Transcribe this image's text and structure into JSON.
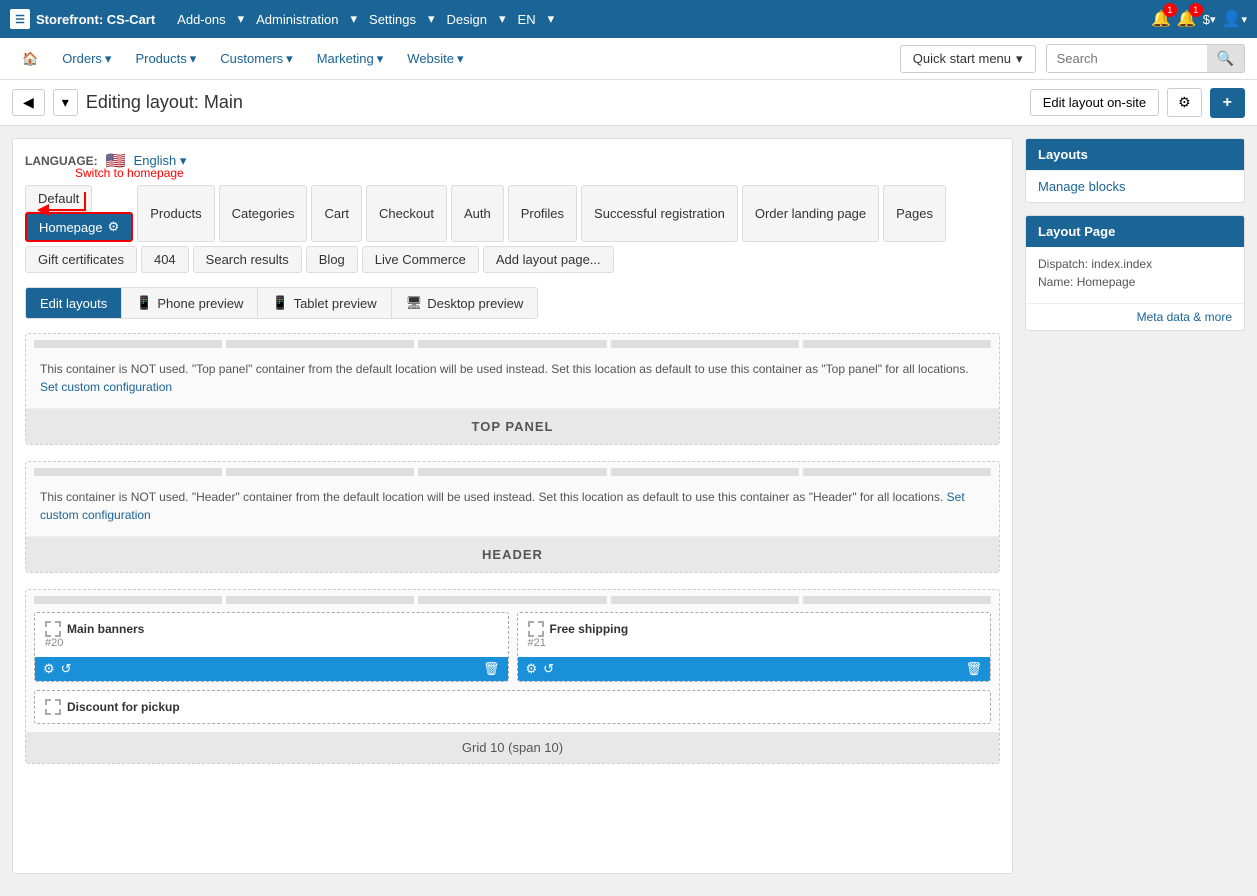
{
  "app": {
    "brand": "Storefront: CS-Cart",
    "brand_icon": "☰"
  },
  "top_nav": {
    "links": [
      {
        "label": "Add-ons",
        "has_dropdown": true
      },
      {
        "label": "Administration",
        "has_dropdown": true
      },
      {
        "label": "Settings",
        "has_dropdown": true
      },
      {
        "label": "Design",
        "has_dropdown": true
      },
      {
        "label": "EN",
        "has_dropdown": true
      }
    ],
    "badge1": "1",
    "badge2": "1",
    "currency": "$",
    "user_icon": "👤"
  },
  "sub_nav": {
    "links": [
      {
        "label": "🏠",
        "id": "home"
      },
      {
        "label": "Orders",
        "has_dropdown": true
      },
      {
        "label": "Products",
        "has_dropdown": true
      },
      {
        "label": "Customers",
        "has_dropdown": true
      },
      {
        "label": "Marketing",
        "has_dropdown": true
      },
      {
        "label": "Website",
        "has_dropdown": true
      }
    ],
    "quick_start_label": "Quick start menu",
    "search_placeholder": "Search"
  },
  "page_header": {
    "back_icon": "◀",
    "nav_icon": "▾",
    "title": "Editing layout: Main",
    "edit_layout_btn": "Edit layout on-site",
    "gear_icon": "⚙",
    "plus_icon": "+"
  },
  "language": {
    "label": "LANGUAGE:",
    "flag": "🇺🇸",
    "current": "English",
    "dropdown": "▾"
  },
  "layout_tabs": [
    {
      "id": "default",
      "label": "Default",
      "active": false
    },
    {
      "id": "homepage",
      "label": "Homepage",
      "active": true,
      "gear": true,
      "highlighted": true
    },
    {
      "id": "products",
      "label": "Products",
      "active": false
    },
    {
      "id": "categories",
      "label": "Categories",
      "active": false
    },
    {
      "id": "cart",
      "label": "Cart",
      "active": false
    },
    {
      "id": "checkout",
      "label": "Checkout",
      "active": false
    },
    {
      "id": "auth",
      "label": "Auth",
      "active": false
    },
    {
      "id": "profiles",
      "label": "Profiles",
      "active": false
    },
    {
      "id": "successful_reg",
      "label": "Successful registration",
      "active": false
    },
    {
      "id": "order_landing",
      "label": "Order landing page",
      "active": false
    },
    {
      "id": "pages",
      "label": "Pages",
      "active": false
    },
    {
      "id": "gift_certificates",
      "label": "Gift certificates",
      "active": false
    },
    {
      "id": "404",
      "label": "404",
      "active": false
    },
    {
      "id": "search_results",
      "label": "Search results",
      "active": false
    },
    {
      "id": "blog",
      "label": "Blog",
      "active": false
    },
    {
      "id": "live_commerce",
      "label": "Live Commerce",
      "active": false
    },
    {
      "id": "add_layout",
      "label": "Add layout page...",
      "active": false
    }
  ],
  "annotation": {
    "text": "Switch to homepage",
    "arrow": "←"
  },
  "view_tabs": [
    {
      "id": "edit_layouts",
      "label": "Edit layouts",
      "active": true,
      "icon": ""
    },
    {
      "id": "phone_preview",
      "label": "Phone preview",
      "active": false,
      "icon": "📱"
    },
    {
      "id": "tablet_preview",
      "label": "Tablet preview",
      "active": false,
      "icon": "📱"
    },
    {
      "id": "desktop_preview",
      "label": "Desktop preview",
      "active": false,
      "icon": "🖥"
    }
  ],
  "top_panel": {
    "notice": "This container is NOT used. \"Top panel\" container from the default location will be used instead. Set this location as default to use this container as \"Top panel\" for all locations.",
    "set_custom_link": "Set custom configuration",
    "label": "TOP PANEL"
  },
  "header_panel": {
    "notice": "This container is NOT used. \"Header\" container from the default location will be used instead. Set this location as default to use this container as \"Header\" for all locations.",
    "set_custom_link": "Set custom configuration",
    "label": "HEADER"
  },
  "blocks": {
    "block1": {
      "title": "Main banners",
      "id": "#20",
      "icon_dashed": "⬚"
    },
    "block2": {
      "title": "Free shipping",
      "id": "#21",
      "icon_dashed": "⬚"
    },
    "block3": {
      "title": "Discount for pickup",
      "icon_dashed": "⬚"
    },
    "grid_label": "Grid 10 (span 10)"
  },
  "sidebar": {
    "layouts_header": "Layouts",
    "manage_blocks_link": "Manage blocks",
    "layout_page_header": "Layout Page",
    "dispatch_label": "Dispatch:",
    "dispatch_value": "index.index",
    "name_label": "Name:",
    "name_value": "Homepage",
    "meta_link": "Meta data & more"
  }
}
